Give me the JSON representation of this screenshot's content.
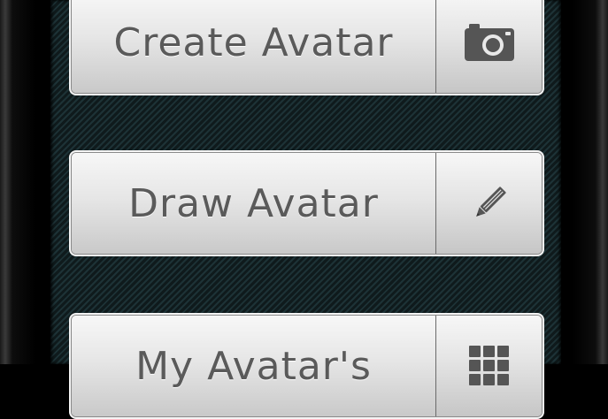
{
  "menu": {
    "buttons": [
      {
        "label": "Create Avatar",
        "icon": "camera-icon"
      },
      {
        "label": "Draw Avatar",
        "icon": "pencil-icon"
      },
      {
        "label": "My Avatar's",
        "icon": "grid-icon"
      }
    ]
  },
  "colors": {
    "button_text": "#5a5a5a",
    "icon": "#555555",
    "background": "#0f1a1c"
  }
}
